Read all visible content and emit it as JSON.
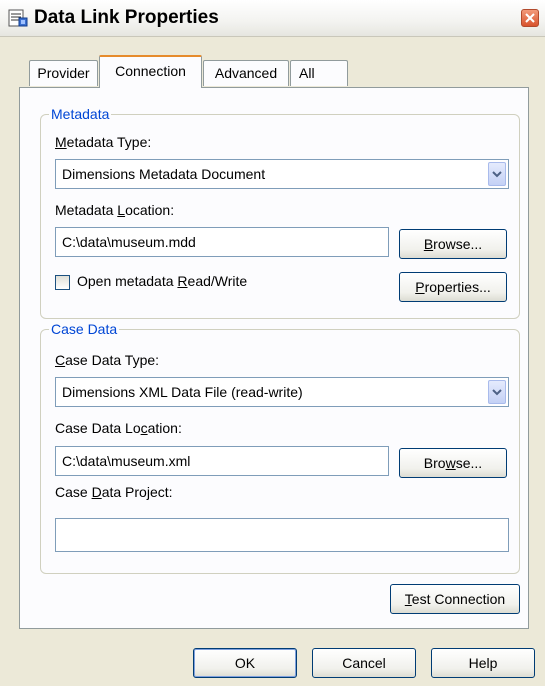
{
  "window": {
    "title": "Data Link Properties",
    "app_icon": "data-link-icon",
    "close_icon": "close-icon"
  },
  "tabs": [
    {
      "label": "Provider",
      "active": false
    },
    {
      "label": "Connection",
      "active": true
    },
    {
      "label": "Advanced",
      "active": false
    },
    {
      "label": "All",
      "active": false
    }
  ],
  "metadata": {
    "group_label": "Metadata",
    "type_label_pre": "",
    "type_label_key": "M",
    "type_label_post": "etadata Type:",
    "type_value": "Dimensions Metadata Document",
    "location_label_pre": "Metadata ",
    "location_label_key": "L",
    "location_label_post": "ocation:",
    "location_value": "C:\\data\\museum.mdd",
    "browse_pre": "",
    "browse_key": "B",
    "browse_post": "rowse...",
    "readwrite_pre": "Open metadata ",
    "readwrite_key": "R",
    "readwrite_post": "ead/Write",
    "readwrite_checked": false,
    "properties_pre": "",
    "properties_key": "P",
    "properties_post": "roperties..."
  },
  "case_data": {
    "group_label": "Case Data",
    "type_label_pre": "",
    "type_label_key": "C",
    "type_label_post": "ase Data Type:",
    "type_value": "Dimensions XML Data File  (read-write)",
    "location_label_pre": "Case Data Lo",
    "location_label_key": "c",
    "location_label_post": "ation:",
    "location_value": "C:\\data\\museum.xml",
    "browse_pre": "Bro",
    "browse_key": "w",
    "browse_post": "se...",
    "project_label_pre": "Case ",
    "project_label_key": "D",
    "project_label_post": "ata Project:",
    "project_value": ""
  },
  "test_connection": {
    "pre": "",
    "key": "T",
    "post": "est Connection"
  },
  "footer": {
    "ok": "OK",
    "cancel": "Cancel",
    "help": "Help"
  }
}
